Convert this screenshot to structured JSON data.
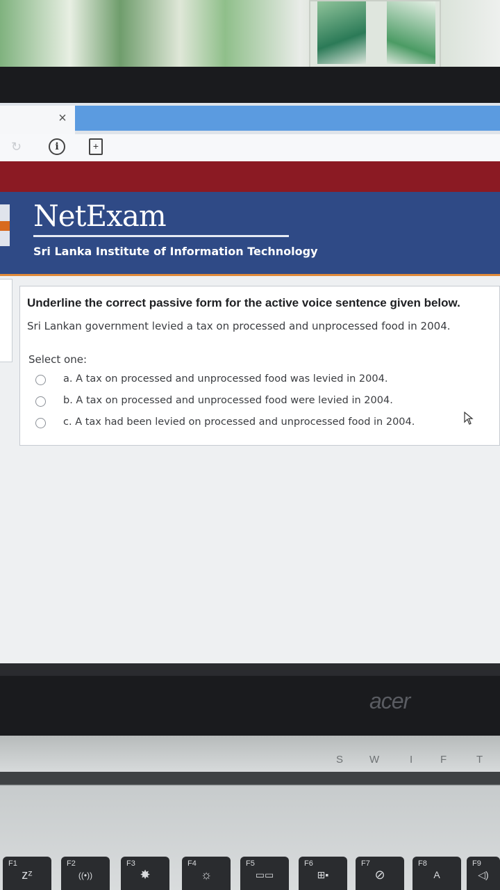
{
  "browser": {
    "tab_close": "×",
    "info_icon_glyph": "i",
    "page_icon_glyph": "+"
  },
  "site": {
    "brand": "NetExam",
    "subtitle": "Sri Lanka Institute of Information Technology"
  },
  "question": {
    "title": "Underline the correct passive form for the active voice sentence given below.",
    "sentence": "Sri Lankan government levied a tax on processed and unprocessed food in 2004.",
    "select_one": "Select one:",
    "options": [
      {
        "label": "a. A tax on processed and unprocessed food was levied in 2004."
      },
      {
        "label": "b. A tax on processed and unprocessed food were levied in 2004."
      },
      {
        "label": "c. A tax had been levied on processed and unprocessed food in 2004."
      }
    ]
  },
  "laptop": {
    "brand": "acer",
    "hinge_labels": [
      "S",
      "W",
      "I",
      "F",
      "T"
    ],
    "keys": [
      {
        "fn": "F1",
        "glyph": "zᶻ",
        "icon": "sleep-icon"
      },
      {
        "fn": "F2",
        "glyph": "((•))",
        "icon": "wireless-icon"
      },
      {
        "fn": "F3",
        "glyph": "✸",
        "icon": "bluetooth-icon"
      },
      {
        "fn": "F4",
        "glyph": "☼",
        "icon": "brightness-icon"
      },
      {
        "fn": "F5",
        "glyph": "▭▭",
        "icon": "display-icon"
      },
      {
        "fn": "F6",
        "glyph": "⊞▪",
        "icon": "touchpad-icon"
      },
      {
        "fn": "F7",
        "glyph": "⊘",
        "icon": "mute-icon"
      },
      {
        "fn": "F8",
        "glyph": "A",
        "icon": "keyboard-light-icon"
      },
      {
        "fn": "F9",
        "glyph": "◁)",
        "icon": "volume-icon"
      }
    ]
  }
}
